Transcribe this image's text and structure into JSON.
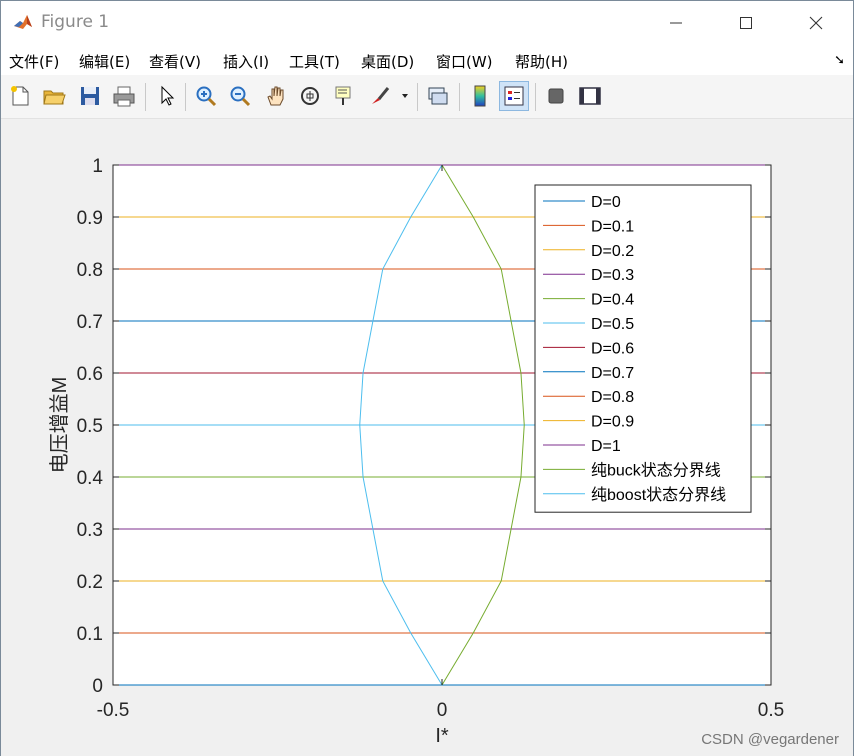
{
  "window": {
    "title": "Figure 1",
    "minimize_icon": "minimize-icon",
    "maximize_icon": "maximize-icon",
    "close_icon": "close-icon"
  },
  "menu": {
    "items": [
      "文件(F)",
      "编辑(E)",
      "查看(V)",
      "插入(I)",
      "工具(T)",
      "桌面(D)",
      "窗口(W)",
      "帮助(H)"
    ]
  },
  "toolbar": {
    "buttons": [
      {
        "icon": "new-figure-icon"
      },
      {
        "icon": "open-file-icon"
      },
      {
        "icon": "save-icon"
      },
      {
        "icon": "print-icon"
      },
      {
        "icon": "pointer-icon"
      },
      {
        "icon": "zoom-in-icon"
      },
      {
        "icon": "zoom-out-icon"
      },
      {
        "icon": "pan-hand-icon"
      },
      {
        "icon": "rotate-3d-icon"
      },
      {
        "icon": "data-cursor-icon"
      },
      {
        "icon": "brush-icon"
      },
      {
        "icon": "link-plot-icon"
      },
      {
        "icon": "colorbar-icon"
      },
      {
        "icon": "legend-icon"
      },
      {
        "icon": "hide-plot-tools-icon"
      },
      {
        "icon": "show-plot-tools-icon"
      }
    ]
  },
  "colors": {
    "c1": "#0072BD",
    "c2": "#D95319",
    "c3": "#EDB120",
    "c4": "#7E2F8E",
    "c5": "#77AC30",
    "c6": "#4DBEEE",
    "c7": "#A2142F"
  },
  "chart_data": {
    "type": "line",
    "title": "",
    "xlabel": "I*",
    "ylabel": "电压增益M",
    "xlim": [
      -0.5,
      0.5
    ],
    "ylim": [
      0,
      1
    ],
    "xticks": [
      "-0.5",
      "0",
      "0.5"
    ],
    "yticks": [
      "0",
      "0.1",
      "0.2",
      "0.3",
      "0.4",
      "0.5",
      "0.6",
      "0.7",
      "0.8",
      "0.9",
      "1"
    ],
    "grid": false,
    "legend_position": "top-right",
    "series": [
      {
        "name": "D=0",
        "color": "#0072BD",
        "x": [
          -0.5,
          0.5
        ],
        "y": [
          0,
          0
        ]
      },
      {
        "name": "D=0.1",
        "color": "#D95319",
        "x": [
          -0.5,
          0.5
        ],
        "y": [
          0.1,
          0.1
        ]
      },
      {
        "name": "D=0.2",
        "color": "#EDB120",
        "x": [
          -0.5,
          0.5
        ],
        "y": [
          0.2,
          0.2
        ]
      },
      {
        "name": "D=0.3",
        "color": "#7E2F8E",
        "x": [
          -0.5,
          0.5
        ],
        "y": [
          0.3,
          0.3
        ]
      },
      {
        "name": "D=0.4",
        "color": "#77AC30",
        "x": [
          -0.5,
          0.5
        ],
        "y": [
          0.4,
          0.4
        ]
      },
      {
        "name": "D=0.5",
        "color": "#4DBEEE",
        "x": [
          -0.5,
          0.5
        ],
        "y": [
          0.5,
          0.5
        ]
      },
      {
        "name": "D=0.6",
        "color": "#A2142F",
        "x": [
          -0.5,
          0.5
        ],
        "y": [
          0.6,
          0.6
        ]
      },
      {
        "name": "D=0.7",
        "color": "#0072BD",
        "x": [
          -0.5,
          0.5
        ],
        "y": [
          0.7,
          0.7
        ]
      },
      {
        "name": "D=0.8",
        "color": "#D95319",
        "x": [
          -0.5,
          0.5
        ],
        "y": [
          0.8,
          0.8
        ]
      },
      {
        "name": "D=0.9",
        "color": "#EDB120",
        "x": [
          -0.5,
          0.5
        ],
        "y": [
          0.9,
          0.9
        ]
      },
      {
        "name": "D=1",
        "color": "#7E2F8E",
        "x": [
          -0.5,
          0.5
        ],
        "y": [
          1,
          1
        ]
      },
      {
        "name": "纯buck状态分界线",
        "color": "#77AC30",
        "x": [
          0,
          0.0475,
          0.09,
          0.105,
          0.12,
          0.125,
          0.12,
          0.105,
          0.09,
          0.0475,
          0
        ],
        "y": [
          0,
          0.1,
          0.2,
          0.3,
          0.4,
          0.5,
          0.6,
          0.7,
          0.8,
          0.9,
          1
        ]
      },
      {
        "name": "纯boost状态分界线",
        "color": "#4DBEEE",
        "x": [
          0,
          -0.0475,
          -0.09,
          -0.105,
          -0.12,
          -0.125,
          -0.12,
          -0.105,
          -0.09,
          -0.0475,
          0
        ],
        "y": [
          0,
          0.1,
          0.2,
          0.3,
          0.4,
          0.5,
          0.6,
          0.7,
          0.8,
          0.9,
          1
        ]
      }
    ]
  },
  "watermark": "CSDN @vegardener"
}
